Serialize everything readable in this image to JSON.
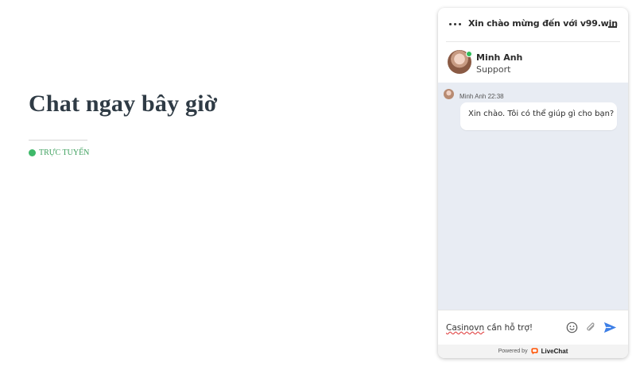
{
  "page": {
    "title": "Chat ngay bây giờ",
    "status_label": "TRỰC TUYẾN",
    "status_color": "#3fb96a"
  },
  "chat": {
    "header": {
      "title": "Xin chào mừng đến với v99.win",
      "menu_icon": "more-dots-icon",
      "minimize_icon": "minimize-icon"
    },
    "agent": {
      "name": "Minh Anh",
      "role": "Support",
      "online": true
    },
    "messages": [
      {
        "sender": "Minh Anh",
        "time": "22:38",
        "text": "Xin chào. Tôi có thể giúp gì cho bạn?"
      }
    ],
    "input": {
      "prefix": "Casinovn",
      "value_rest": " cần hỗ trợ!"
    },
    "footer": {
      "powered_by": "Powered by",
      "brand": "LiveChat",
      "brand_color": "#ff5100"
    },
    "accent_color": "#3d7fe6"
  }
}
